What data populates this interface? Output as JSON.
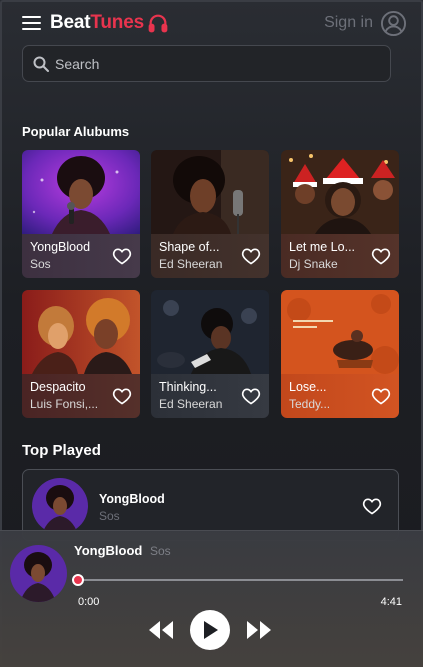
{
  "header": {
    "logo_part1": "Beat",
    "logo_part2": "Tunes",
    "menu_icon": "hamburger-icon",
    "logo_icon": "headphones-icon",
    "signin_label": "Sign in",
    "signin_icon": "user-circle-icon"
  },
  "search": {
    "placeholder": "Search",
    "icon": "search-icon"
  },
  "popular": {
    "title": "Popular Alubums",
    "albums": [
      {
        "name": "YongBlood",
        "artist": "Sos"
      },
      {
        "name": "Shape of...",
        "artist": "Ed Sheeran"
      },
      {
        "name": "Let me Lo...",
        "artist": "Dj Snake"
      },
      {
        "name": "Despacito",
        "artist": "Luis Fonsi,..."
      },
      {
        "name": "Thinking...",
        "artist": "Ed Sheeran"
      },
      {
        "name": "Lose...",
        "artist": "Teddy..."
      }
    ]
  },
  "top_played": {
    "title": "Top Played",
    "items": [
      {
        "name": "YongBlood",
        "artist": "Sos"
      }
    ]
  },
  "player": {
    "track": "YongBlood",
    "artist": "Sos",
    "time_current": "0:00",
    "time_total": "4:41",
    "progress": 0.0,
    "icons": [
      "previous-icon",
      "play-icon",
      "next-icon"
    ]
  },
  "colors": {
    "accent": "#e8344e",
    "background": "#1d1f24",
    "muted": "#6d7079"
  }
}
